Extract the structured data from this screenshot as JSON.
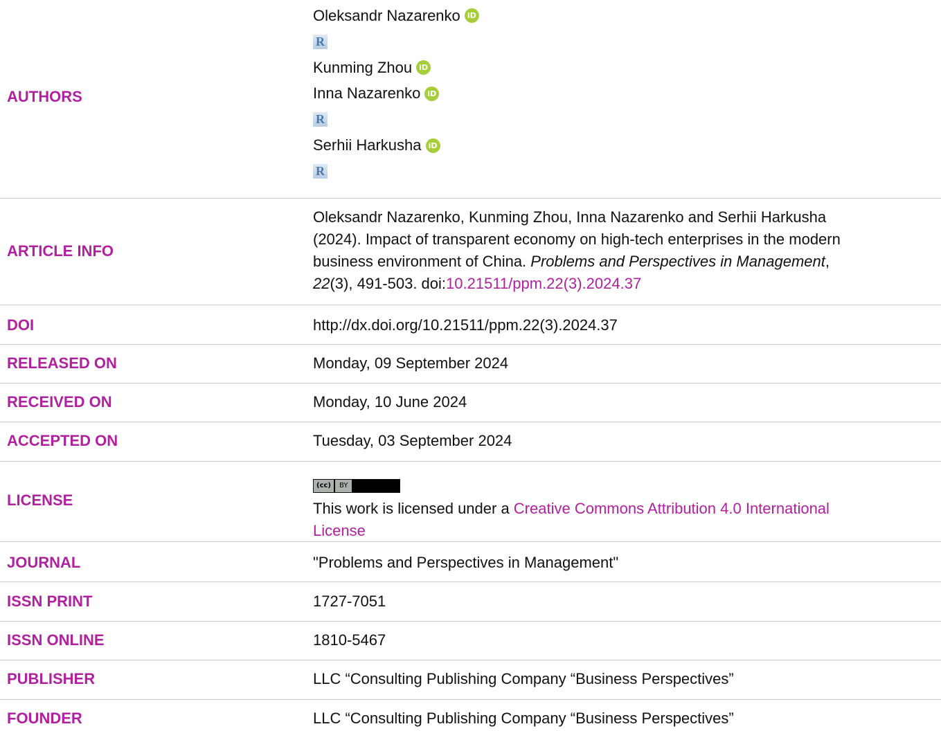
{
  "authors": {
    "label": "AUTHORS",
    "names": [
      "Oleksandr Nazarenko",
      "Kunming Zhou",
      "Inna Nazarenko",
      "Serhii Harkusha"
    ],
    "orcid_icon_text": "iD",
    "rg_icon_text": "R"
  },
  "article_info": {
    "label": "ARTICLE INFO",
    "line1": "Oleksandr Nazarenko, Kunming Zhou, Inna Nazarenko and Serhii Harkusha",
    "line2": "(2024). Impact of transparent economy on high-tech enterprises in the modern",
    "line3a": "business environment of China. ",
    "journal_italic": "Problems and Perspectives in Management",
    "line3b": ",",
    "volume_italic": "22",
    "line4a": "(3), 491-503. doi:",
    "doi_link": "10.21511/ppm.22(3).2024.37"
  },
  "doi": {
    "label": "DOI",
    "value": "http://dx.doi.org/10.21511/ppm.22(3).2024.37"
  },
  "released": {
    "label": "RELEASED ON",
    "value": "Monday, 09 September 2024"
  },
  "received": {
    "label": "RECEIVED ON",
    "value": "Monday, 10 June 2024"
  },
  "accepted": {
    "label": "ACCEPTED ON",
    "value": "Tuesday, 03 September 2024"
  },
  "license": {
    "label": "LICENSE",
    "badge_cc": "(cc)",
    "badge_by": "BY",
    "text": "This work is licensed under a ",
    "link_line1": "Creative Commons Attribution 4.0 International",
    "link_line2": "License"
  },
  "journal": {
    "label": "JOURNAL",
    "value": "\"Problems and Perspectives in Management\""
  },
  "issn_print": {
    "label": "ISSN PRINT",
    "value": "1727-7051"
  },
  "issn_online": {
    "label": "ISSN ONLINE",
    "value": "1810-5467"
  },
  "publisher": {
    "label": "PUBLISHER",
    "value": "LLC “Consulting Publishing Company “Business Perspectives”"
  },
  "founder": {
    "label": "FOUNDER",
    "value": "LLC “Consulting Publishing Company “Business Perspectives”"
  },
  "colors": {
    "accent": "#b1219f",
    "orcid": "#a6ce39",
    "separator": "#c9c9c9"
  }
}
